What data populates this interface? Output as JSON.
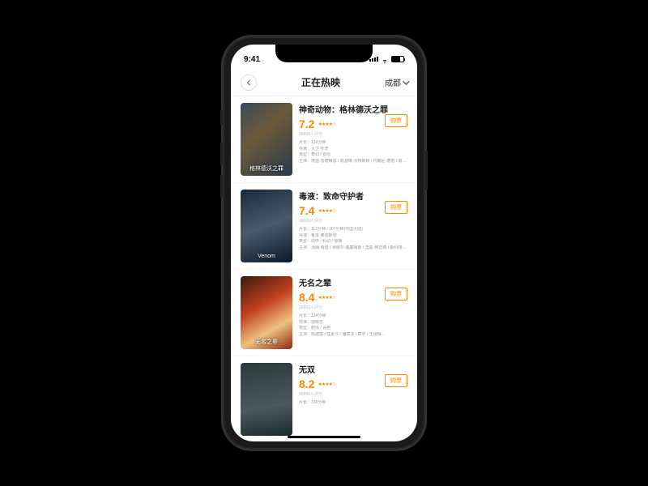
{
  "status_bar": {
    "time": "9:41"
  },
  "header": {
    "title": "正在热映",
    "city": "成都",
    "buy_label": "购票"
  },
  "movies": [
    {
      "title": "神奇动物：格林德沃之罪",
      "score": "7.2",
      "stars": "★★★★☆",
      "count": "99999人评分",
      "poster_text": "格林德沃之罪",
      "meta": [
        "片长：134分钟",
        "导演：大卫·叶茨",
        "类型：奇幻 / 冒险",
        "主演：埃迪·雷德梅恩 / 凯瑟琳·沃特斯顿 / 约翰尼·德普 / 裘德·洛 / 丹·福勒…"
      ]
    },
    {
      "title": "毒液：致命守护者",
      "score": "7.4",
      "stars": "★★★★☆",
      "count": "99999人评分",
      "poster_text": "Venom",
      "meta": [
        "片长：112分钟 / 107分钟(中国大陆)",
        "导演：鲁本·弗雷斯彻",
        "类型：动作 / 科幻 / 惊悚",
        "主演：汤姆·哈迪 / 米歇尔·威廉姆斯 / 里兹·阿迈德 / 斯科特·黑兹 / 瑞德…"
      ]
    },
    {
      "title": "无名之辈",
      "score": "8.4",
      "stars": "★★★★☆",
      "count": "99999人评分",
      "poster_text": "无名之辈",
      "meta": [
        "片长：134分钟",
        "导演：饶晓志",
        "类型：剧情 / 喜剧",
        "主演：陈建斌 / 任素汐 / 潘斌龙 / 章宇 / 王砚辉…"
      ]
    },
    {
      "title": "无双",
      "score": "8.2",
      "stars": "★★★★☆",
      "count": "99999人评分",
      "poster_text": "",
      "meta": [
        "片长：130分钟"
      ]
    }
  ]
}
